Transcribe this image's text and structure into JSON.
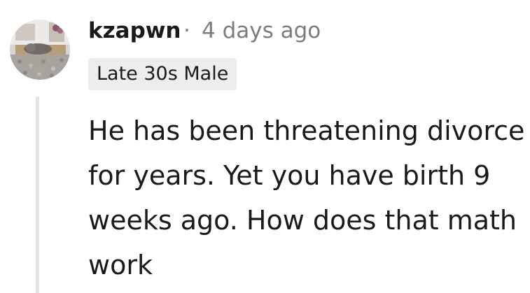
{
  "comment": {
    "username": "kzapwn",
    "separator": "·",
    "timestamp": "4 days ago",
    "flair": "Late 30s Male",
    "body": "He has been threatening divorce for years. Yet you have birth 9 weeks ago. How does that math work"
  },
  "colors": {
    "text": "#1a1a1b",
    "meta": "#7c7c7c",
    "flair_bg": "#ededed",
    "thread_line": "#e3e5e7"
  },
  "icons": {
    "avatar": "user-avatar-photo-cat"
  }
}
